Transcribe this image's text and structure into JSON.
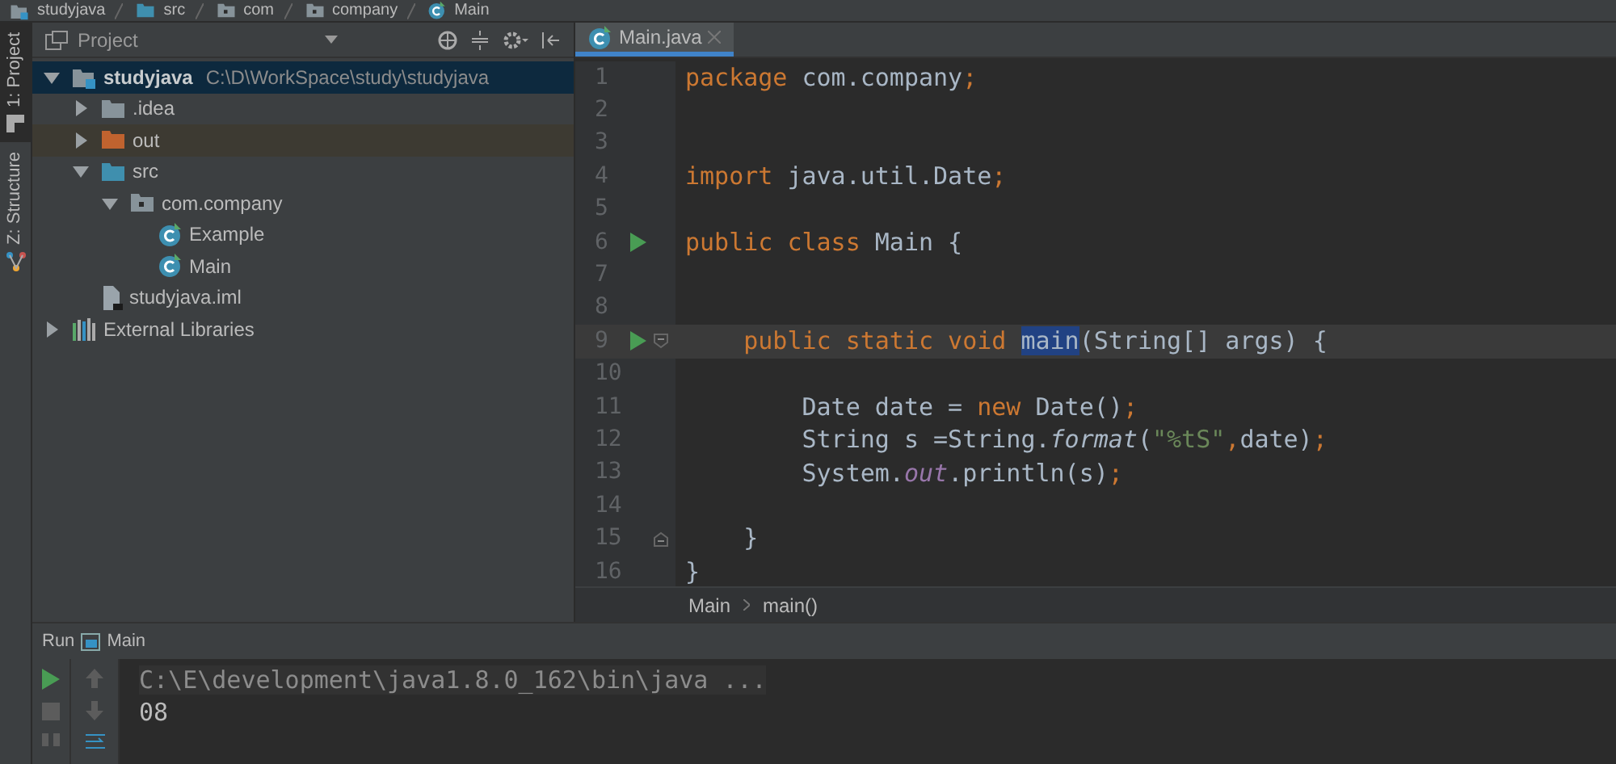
{
  "navigation_bar": [
    {
      "label": "studyjava",
      "kind": "module"
    },
    {
      "label": "src",
      "kind": "source-folder"
    },
    {
      "label": "com",
      "kind": "package"
    },
    {
      "label": "company",
      "kind": "package"
    },
    {
      "label": "Main",
      "kind": "class"
    }
  ],
  "tool_strip": [
    {
      "label": "1: Project",
      "kind": "project",
      "selected": true
    },
    {
      "label": "Z: Structure",
      "kind": "structure",
      "selected": false
    }
  ],
  "project_panel": {
    "title": "Project",
    "tree": [
      {
        "label": "studyjava",
        "kind": "module",
        "path": "C:\\D\\WorkSpace\\study\\studyjava",
        "expanded": true,
        "selected": true,
        "children": [
          {
            "label": ".idea",
            "kind": "folder",
            "expanded": false,
            "selected": false
          },
          {
            "label": "out",
            "kind": "excluded-folder",
            "expanded": false,
            "selected": false
          },
          {
            "label": "src",
            "kind": "source-folder",
            "expanded": true,
            "selected": false,
            "children": [
              {
                "label": "com.company",
                "kind": "package",
                "expanded": true,
                "selected": false,
                "children": [
                  {
                    "label": "Example",
                    "kind": "class",
                    "selected": false
                  },
                  {
                    "label": "Main",
                    "kind": "class",
                    "selected": false
                  }
                ]
              }
            ]
          },
          {
            "label": "studyjava.iml",
            "kind": "file",
            "selected": false
          }
        ]
      },
      {
        "label": "External Libraries",
        "kind": "libraries",
        "expanded": false,
        "selected": false
      }
    ]
  },
  "editor": {
    "tabs": [
      {
        "label": "Main.java",
        "selected": true
      }
    ],
    "lines": [
      {
        "number": "1",
        "run": false,
        "fold_start": false,
        "fold_end": false,
        "current": false,
        "tokens": [
          {
            "text": "package",
            "kind": "keyword"
          },
          {
            "text": " com.company",
            "kind": "plain"
          },
          {
            "text": ";",
            "kind": "keyword"
          }
        ]
      },
      {
        "number": "2",
        "run": false,
        "fold_start": false,
        "fold_end": false,
        "current": false
      },
      {
        "number": "3",
        "run": false,
        "fold_start": false,
        "fold_end": false,
        "current": false
      },
      {
        "number": "4",
        "run": false,
        "fold_start": false,
        "fold_end": false,
        "current": false,
        "tokens": [
          {
            "text": "import",
            "kind": "keyword"
          },
          {
            "text": " java.util.Date",
            "kind": "plain"
          },
          {
            "text": ";",
            "kind": "keyword"
          }
        ]
      },
      {
        "number": "5",
        "run": false,
        "fold_start": false,
        "fold_end": false,
        "current": false
      },
      {
        "number": "6",
        "run": true,
        "fold_start": false,
        "fold_end": false,
        "current": false,
        "tokens": [
          {
            "text": "public class",
            "kind": "keyword"
          },
          {
            "text": " Main {",
            "kind": "plain"
          }
        ]
      },
      {
        "number": "7",
        "run": false,
        "fold_start": false,
        "fold_end": false,
        "current": false
      },
      {
        "number": "8",
        "run": false,
        "fold_start": false,
        "fold_end": false,
        "current": false
      },
      {
        "number": "9",
        "run": true,
        "fold_start": true,
        "fold_end": false,
        "current": true,
        "tokens": [
          {
            "text": "    public static void ",
            "kind": "keyword"
          },
          {
            "text": "main",
            "kind": "match"
          },
          {
            "text": "(String[] args) {",
            "kind": "plain"
          }
        ]
      },
      {
        "number": "10",
        "run": false,
        "fold_start": false,
        "fold_end": false,
        "current": false
      },
      {
        "number": "11",
        "run": false,
        "fold_start": false,
        "fold_end": false,
        "current": false,
        "tokens": [
          {
            "text": "        Date date = ",
            "kind": "plain"
          },
          {
            "text": "new",
            "kind": "keyword"
          },
          {
            "text": " Date()",
            "kind": "plain"
          },
          {
            "text": ";",
            "kind": "keyword"
          }
        ]
      },
      {
        "number": "12",
        "run": false,
        "fold_start": false,
        "fold_end": false,
        "current": false,
        "tokens": [
          {
            "text": "        String s =String.",
            "kind": "plain"
          },
          {
            "text": "format",
            "kind": "static-method"
          },
          {
            "text": "(",
            "kind": "plain"
          },
          {
            "text": "\"%tS\"",
            "kind": "string"
          },
          {
            "text": ",",
            "kind": "keyword"
          },
          {
            "text": "date)",
            "kind": "plain"
          },
          {
            "text": ";",
            "kind": "keyword"
          }
        ]
      },
      {
        "number": "13",
        "run": false,
        "fold_start": false,
        "fold_end": false,
        "current": false,
        "tokens": [
          {
            "text": "        System.",
            "kind": "plain"
          },
          {
            "text": "out",
            "kind": "static-field"
          },
          {
            "text": ".println(s)",
            "kind": "plain"
          },
          {
            "text": ";",
            "kind": "keyword"
          }
        ]
      },
      {
        "number": "14",
        "run": false,
        "fold_start": false,
        "fold_end": false,
        "current": false
      },
      {
        "number": "15",
        "run": false,
        "fold_start": false,
        "fold_end": true,
        "current": false,
        "tokens": [
          {
            "text": "    }",
            "kind": "plain"
          }
        ]
      },
      {
        "number": "16",
        "run": false,
        "fold_start": false,
        "fold_end": false,
        "current": false,
        "tokens": [
          {
            "text": "}",
            "kind": "plain"
          }
        ]
      }
    ],
    "breadcrumbs": [
      "Main",
      "main()"
    ]
  },
  "run_panel": {
    "title": "Run",
    "config": "Main",
    "console": [
      {
        "text": "C:\\E\\development\\java1.8.0_162\\bin\\java ...",
        "kind": "command"
      },
      {
        "text": "08",
        "kind": "output"
      }
    ]
  }
}
